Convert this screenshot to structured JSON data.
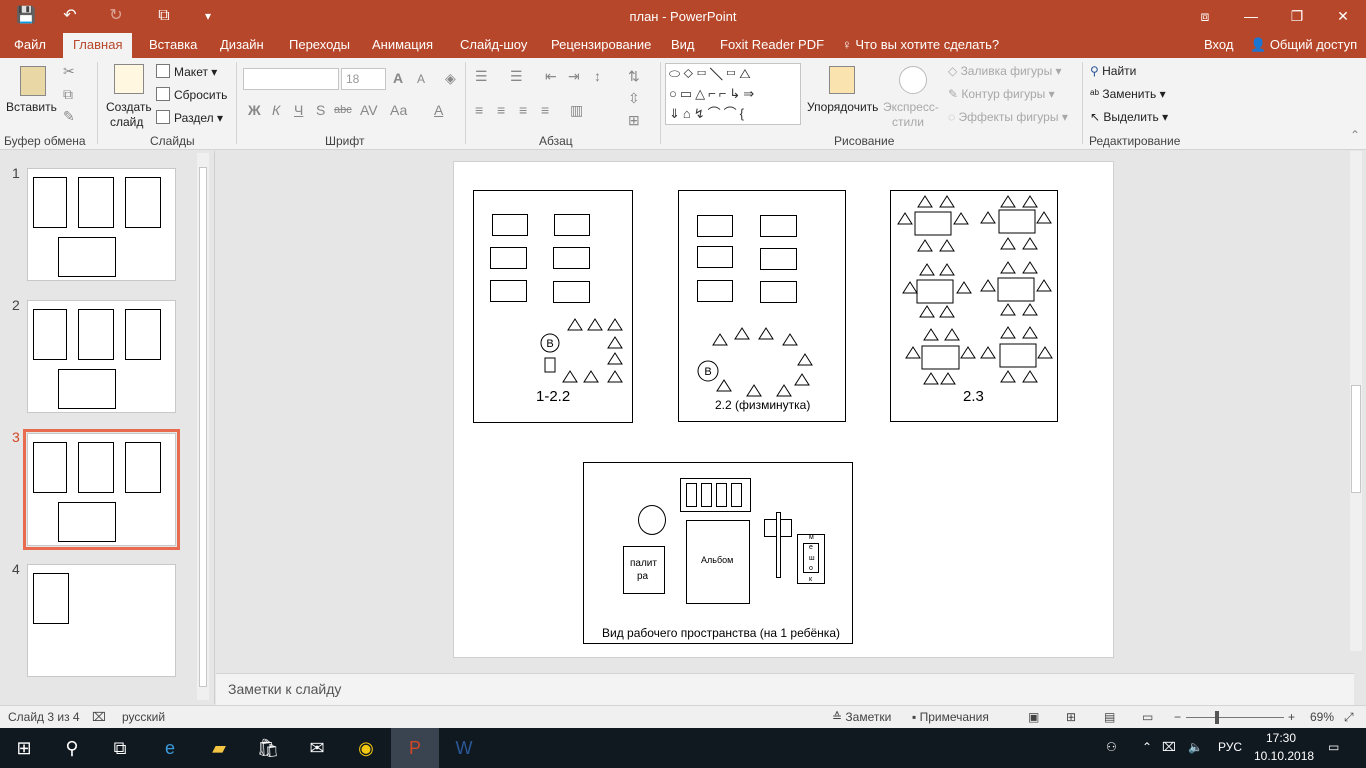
{
  "window": {
    "title": "план - PowerPoint",
    "save_icon": "💾",
    "undo_icon": "↶",
    "redo_icon": "↻",
    "present_icon": "⧉",
    "customize_icon": "▾",
    "ribbon_display_icon": "⧈",
    "minimize_icon": "—",
    "restore_icon": "❐",
    "close_icon": "✕"
  },
  "tabs": {
    "file": "Файл",
    "home": "Главная",
    "insert": "Вставка",
    "design": "Дизайн",
    "transitions": "Переходы",
    "animation": "Анимация",
    "slideshow": "Слайд-шоу",
    "review": "Рецензирование",
    "view": "Вид",
    "foxit": "Foxit Reader PDF",
    "tell_me": "Что вы хотите сделать?",
    "login": "Вход",
    "share": "Общий доступ"
  },
  "ribbon": {
    "clipboard": {
      "paste": "Вставить",
      "group": "Буфер обмена"
    },
    "slides": {
      "new_slide_1": "Создать",
      "new_slide_2": "слайд",
      "layout": "Макет",
      "reset": "Сбросить",
      "section": "Раздел",
      "group": "Слайды"
    },
    "font": {
      "font_size": "18",
      "bold": "Ж",
      "italic": "К",
      "underline": "Ч",
      "shadow": "S",
      "strike": "abc",
      "spacing": "AV",
      "case": "Аа",
      "color": "A",
      "grow": "A",
      "shrink": "A",
      "group": "Шрифт"
    },
    "paragraph": {
      "group": "Абзац"
    },
    "drawing": {
      "arrange": "Упорядочить",
      "quick_styles_1": "Экспресс-",
      "quick_styles_2": "стили",
      "fill": "Заливка фигуры",
      "outline": "Контур фигуры",
      "effects": "Эффекты фигуры",
      "group": "Рисование"
    },
    "editing": {
      "find": "Найти",
      "replace": "Заменить",
      "select": "Выделить",
      "group": "Редактирование"
    }
  },
  "thumbnails": [
    {
      "number": "1"
    },
    {
      "number": "2"
    },
    {
      "number": "3"
    },
    {
      "number": "4"
    }
  ],
  "slide": {
    "plan1_label": "1-2.2",
    "plan2_label": "2.2 (физминутка)",
    "plan3_label": "2.3",
    "teacher_marker": "В",
    "workspace_caption": "Вид рабочего пространства (на 1 ребёнка)",
    "palette_label_1": "палит",
    "palette_label_2": "ра",
    "album_label": "Альбом",
    "sponge_letters": [
      "м",
      "е",
      "ш",
      "о",
      "к"
    ]
  },
  "notes": {
    "placeholder": "Заметки к слайду"
  },
  "statusbar": {
    "slide_info": "Слайд 3 из 4",
    "language": "русский",
    "notes_btn": "Заметки",
    "comments_btn": "Примечания",
    "zoom": "69%"
  },
  "taskbar": {
    "lang": "РУС",
    "time": "17:30",
    "date": "10.10.2018"
  }
}
